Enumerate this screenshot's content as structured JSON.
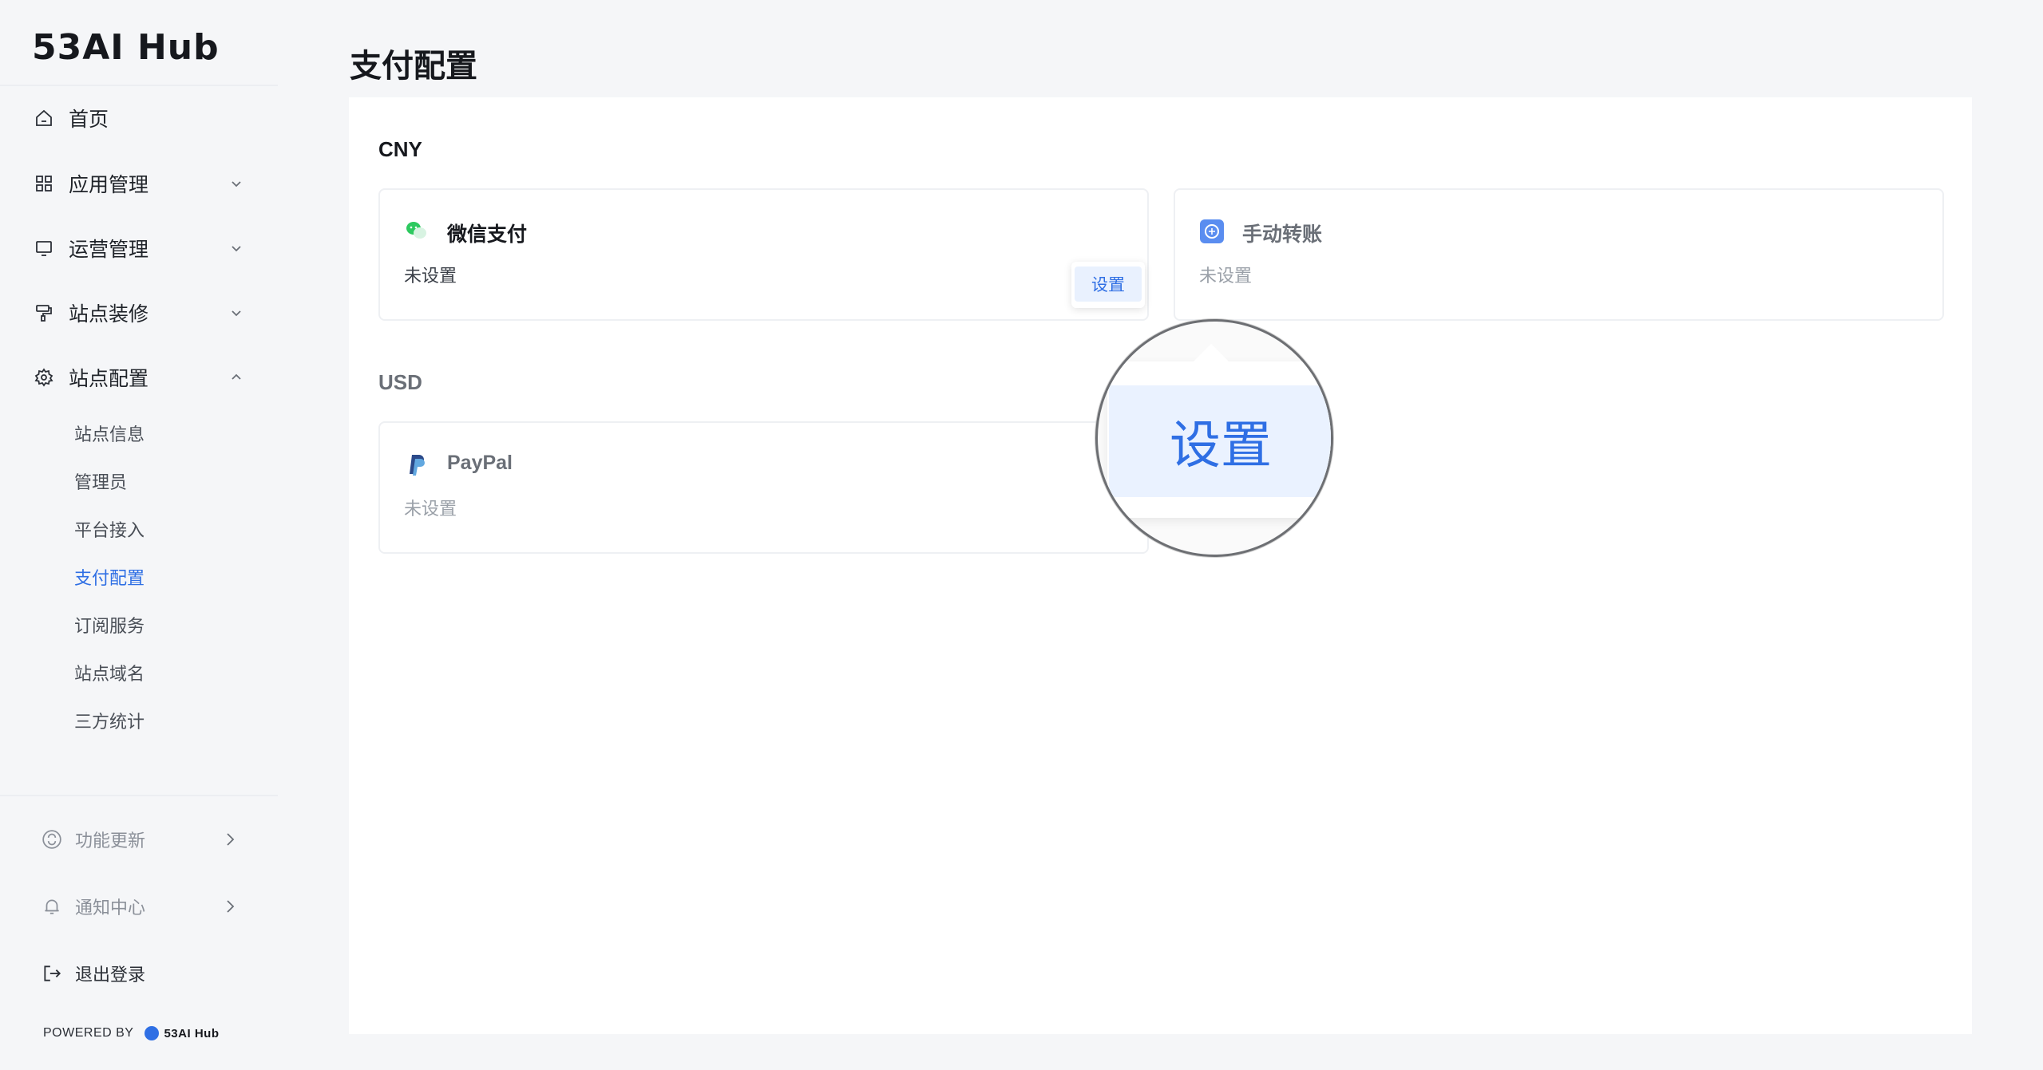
{
  "sidebar": {
    "logo": "53AI Hub",
    "items": [
      {
        "label": "首页",
        "icon": "home-icon"
      },
      {
        "label": "应用管理",
        "icon": "grid-icon"
      },
      {
        "label": "运营管理",
        "icon": "monitor-icon"
      },
      {
        "label": "站点装修",
        "icon": "paint-roller-icon"
      },
      {
        "label": "站点配置",
        "icon": "gear-icon"
      }
    ],
    "sub_items": [
      {
        "label": "站点信息"
      },
      {
        "label": "管理员"
      },
      {
        "label": "平台接入"
      },
      {
        "label": "支付配置"
      },
      {
        "label": "订阅服务"
      },
      {
        "label": "站点域名"
      },
      {
        "label": "三方统计"
      }
    ],
    "bottom": {
      "update_label": "功能更新",
      "notify_label": "通知中心",
      "logout_label": "退出登录",
      "powered_by": "POWERED BY",
      "powered_logo": "53AI Hub"
    }
  },
  "main": {
    "title": "支付配置",
    "sections": [
      {
        "title": "CNY",
        "cards": [
          {
            "name": "微信支付",
            "status": "未设置",
            "icon": "wechat-pay-icon"
          },
          {
            "name": "手动转账",
            "status": "未设置",
            "icon": "transfer-icon"
          }
        ]
      },
      {
        "title": "USD",
        "cards": [
          {
            "name": "PayPal",
            "status": "未设置",
            "icon": "paypal-icon"
          }
        ]
      }
    ],
    "popover": {
      "button_label": "设置"
    },
    "magnifier": {
      "label": "设置"
    }
  },
  "colors": {
    "accent": "#2f6fe4",
    "wechat": "#2dc95f",
    "transfer": "#5a8df0"
  }
}
